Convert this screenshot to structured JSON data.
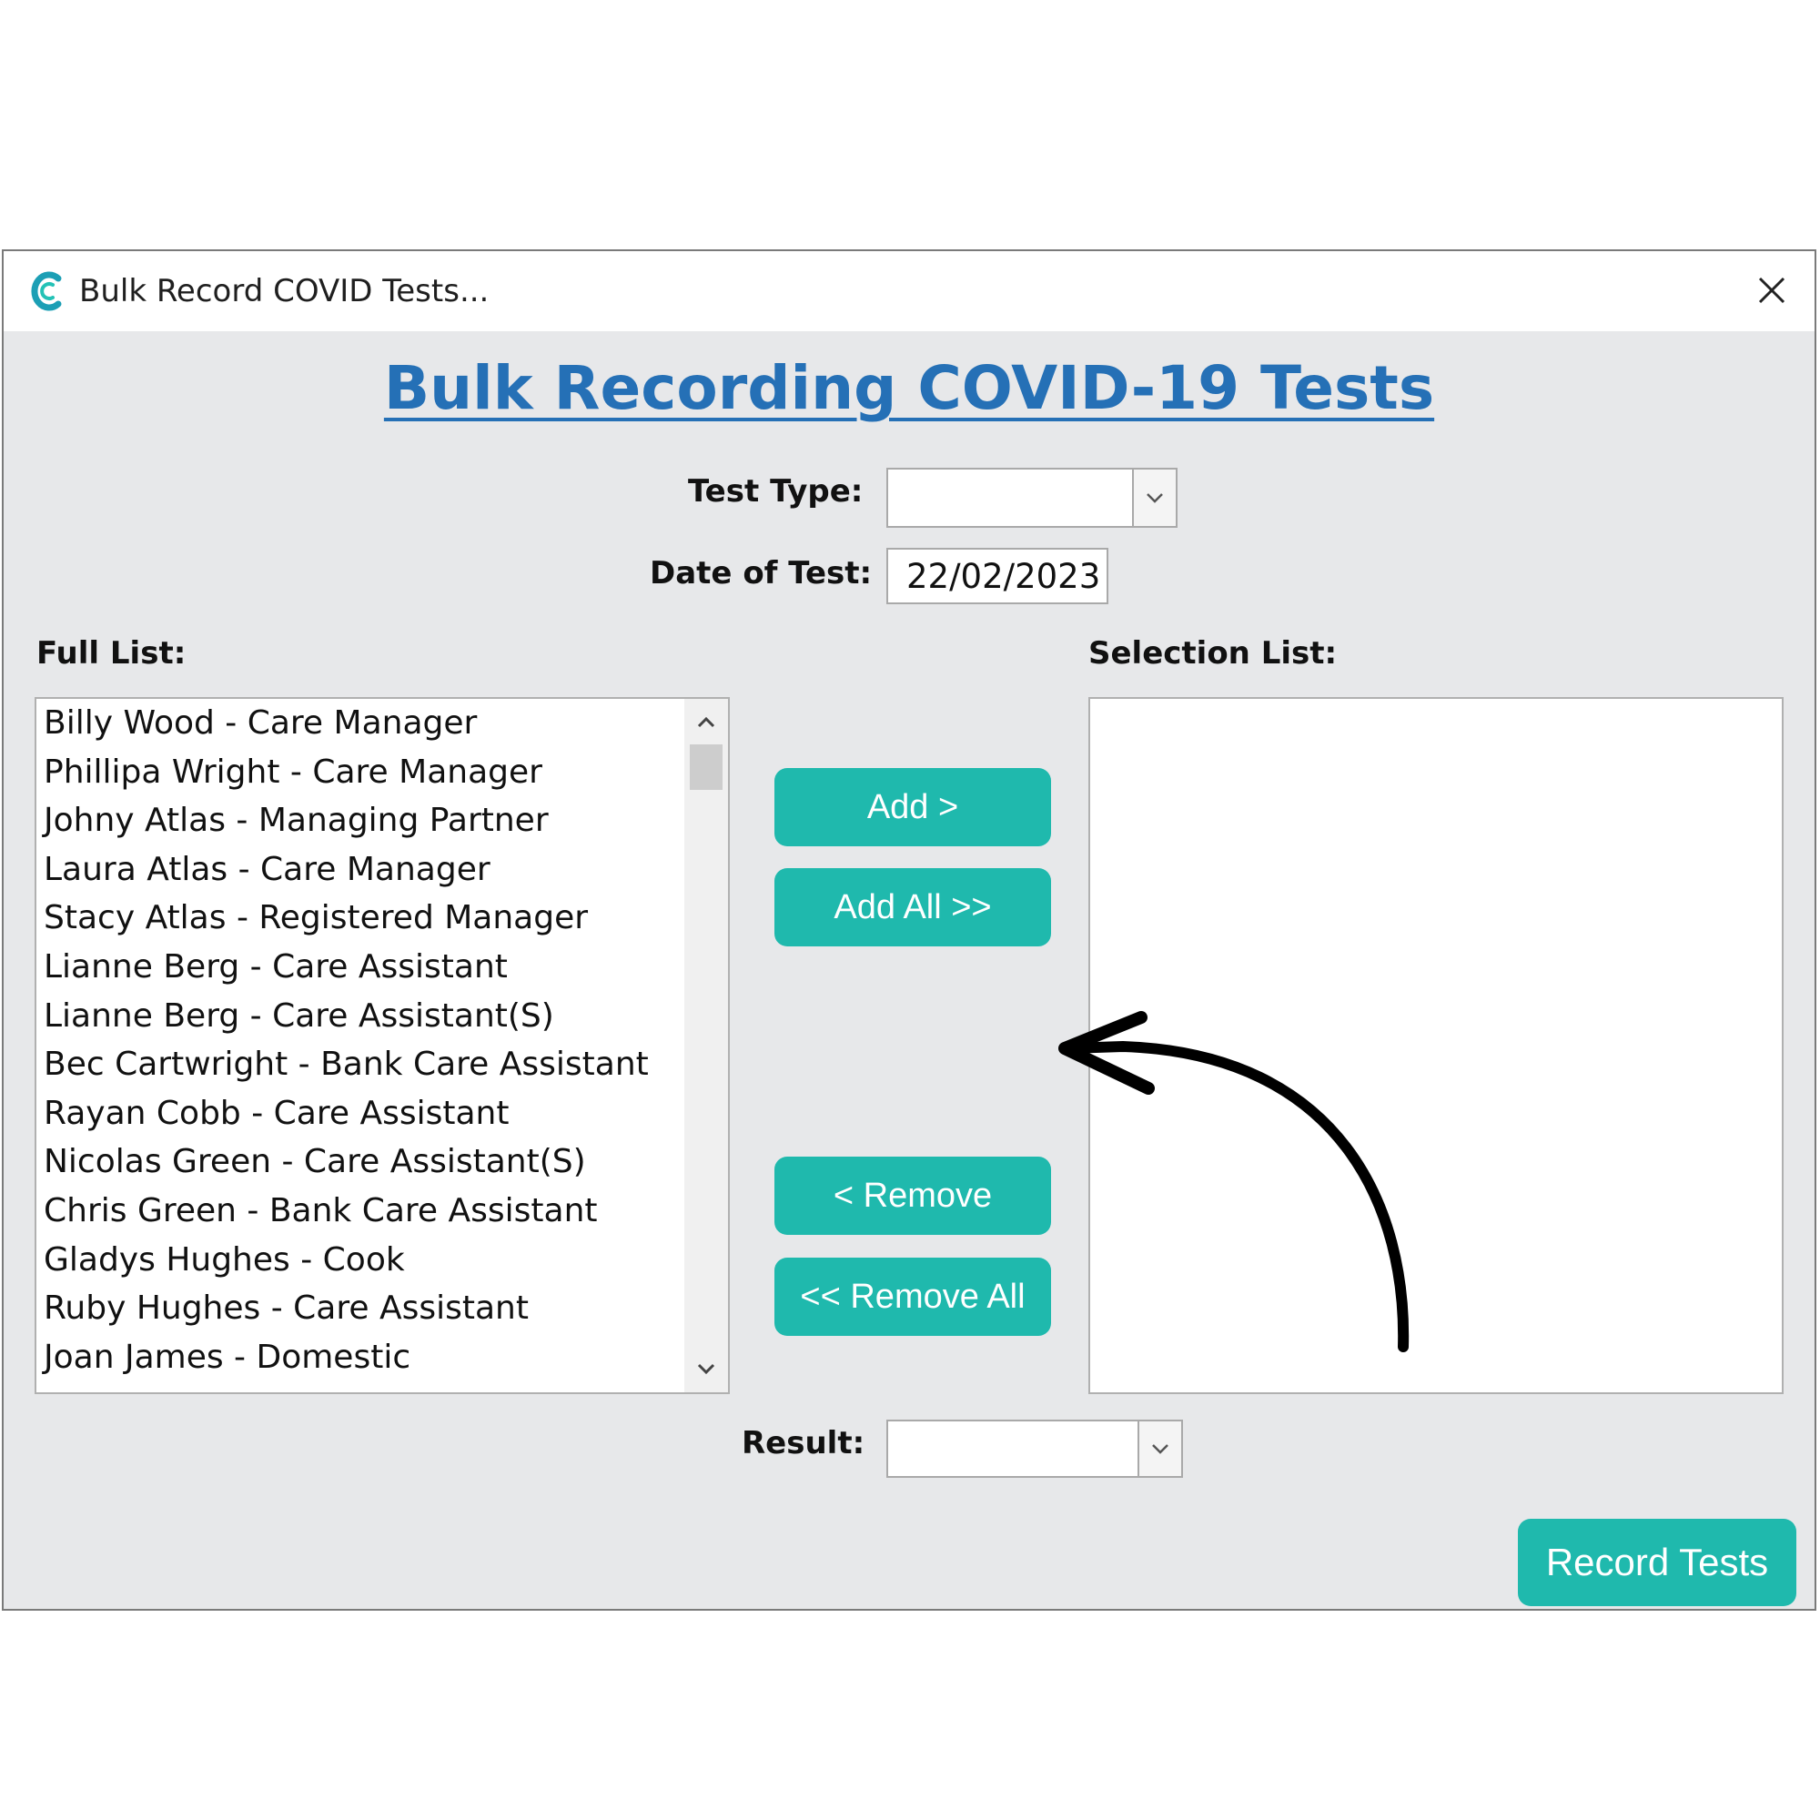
{
  "window": {
    "title": "Bulk Record COVID Tests...",
    "app_icon": "c-logo-icon",
    "close_icon": "close-icon"
  },
  "heading": "Bulk Recording COVID-19 Tests",
  "test_type": {
    "label": "Test Type:",
    "value": ""
  },
  "date_of_test": {
    "label": "Date of Test:",
    "value": "22/02/2023"
  },
  "full_list": {
    "label": "Full List:",
    "items": [
      "Billy Wood - Care Manager",
      "Phillipa Wright - Care Manager",
      "Johny Atlas - Managing Partner",
      "Laura Atlas - Care Manager",
      "Stacy Atlas - Registered Manager",
      "Lianne Berg - Care Assistant",
      "Lianne Berg - Care Assistant(S)",
      "Bec Cartwright - Bank Care Assistant",
      "Rayan Cobb - Care Assistant",
      "Nicolas Green - Care Assistant(S)",
      "Chris Green - Bank Care Assistant",
      "Gladys Hughes - Cook",
      "Ruby Hughes - Care Assistant",
      "Joan James - Domestic"
    ]
  },
  "selection_list": {
    "label": "Selection List:",
    "items": []
  },
  "buttons": {
    "add": "Add >",
    "add_all": "Add All >>",
    "remove": "< Remove",
    "remove_all": "<< Remove All",
    "record": "Record Tests"
  },
  "result": {
    "label": "Result:",
    "value": ""
  },
  "colors": {
    "accent": "#1fb9ad",
    "heading": "#2570b6",
    "background": "#e7e8ea"
  }
}
